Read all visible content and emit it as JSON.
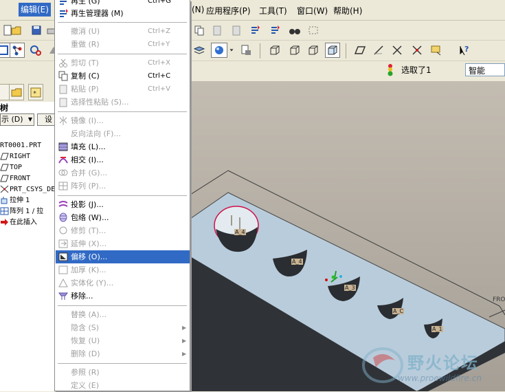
{
  "menubar": {
    "edit": "编辑(E)",
    "hidden_left": "",
    "apps": "应用程序(P)",
    "tools": "工具(T)",
    "window": "窗口(W)",
    "help": "帮助(H)",
    "partial": "(N)"
  },
  "status": {
    "selected_text": "选取了1",
    "filter_value": "智能"
  },
  "model_tree": {
    "title": "树",
    "show_label": "示 (D)",
    "settings_label": "设",
    "items": [
      {
        "label": "RT0001.PRT"
      },
      {
        "label": "RIGHT"
      },
      {
        "label": "TOP"
      },
      {
        "label": "FRONT"
      },
      {
        "label": "PRT_CSYS_DEF"
      },
      {
        "label": "拉伸 1"
      },
      {
        "label": "阵列 1 / 拉"
      },
      {
        "label": "在此插入"
      }
    ]
  },
  "edit_menu": {
    "regen": "再生 (G)",
    "regen_short": "Ctrl+G",
    "regen_manager": "再生管理器 (M)",
    "undo": "撤消 (U)",
    "undo_short": "Ctrl+Z",
    "redo": "重做 (R)",
    "redo_short": "Ctrl+Y",
    "cut": "剪切 (T)",
    "cut_short": "Ctrl+X",
    "copy": "复制 (C)",
    "copy_short": "Ctrl+C",
    "paste": "粘贴 (P)",
    "paste_short": "Ctrl+V",
    "paste_special": "选择性粘贴 (S)...",
    "mirror": "镜像 (I)...",
    "reverse_normal": "反向法向 (F)...",
    "fill": "填充 (L)...",
    "intersect": "相交 (I)...",
    "merge": "合并 (G)...",
    "pattern": "阵列 (P)...",
    "project": "投影 (J)...",
    "wrap": "包络 (W)...",
    "trim": "修剪 (T)...",
    "extend": "延伸 (X)...",
    "offset": "偏移 (O)...",
    "thicken": "加厚 (K)...",
    "solidify": "实体化 (Y)...",
    "remove": "移除...",
    "replace": "替换 (A)...",
    "hide": "隐含 (S)",
    "resume": "恢复 (U)",
    "delete": "删除 (D)",
    "references": "参照 (R)",
    "definition": "定义 (E)"
  },
  "viewport": {
    "labels": [
      "A_4",
      "A_4",
      "A_3",
      "A_C",
      "A_1"
    ],
    "front_label": "FRO"
  },
  "watermark": {
    "title": "野火论坛",
    "url": "www.proewildfire.cn"
  },
  "colors": {
    "highlight": "#316ac5",
    "panel_bg": "#ece9d8",
    "model": "#b8cad8"
  }
}
